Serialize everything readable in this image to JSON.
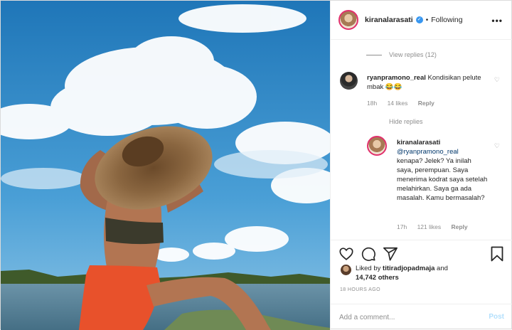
{
  "post": {
    "username": "kiranalarasati",
    "dot": "•",
    "follow_status": "Following",
    "more": "•••"
  },
  "comments": {
    "view_replies": "View replies (12)",
    "hide_replies": "Hide replies",
    "items": [
      {
        "username": "ryanpramono_real",
        "text": " Kondisikan pelute mbak 😂😂",
        "age": "18h",
        "likes": "14 likes",
        "reply": "Reply"
      },
      {
        "username": "kiranalarasati",
        "mention": "@ryanpramono_real",
        "text": "kenapa? Jelek? Ya inilah saya, perempuan. Saya menerima kodrat saya setelah melahirkan. Saya ga ada masalah. Kamu bermasalah?",
        "age": "17h",
        "likes": "121 likes",
        "reply": "Reply"
      }
    ]
  },
  "likes": {
    "prefix": "Liked by ",
    "liker": "titiradjopadmaja",
    "mid": " and ",
    "others": "14,742 others"
  },
  "time_ago": "18 HOURS AGO",
  "add_comment": {
    "placeholder": "Add a comment...",
    "post_label": "Post"
  },
  "colors": {
    "accent": "#3897f0",
    "story_ring": "#e1306c",
    "muted": "#8e8e8e",
    "post_disabled": "#b2dffc"
  }
}
